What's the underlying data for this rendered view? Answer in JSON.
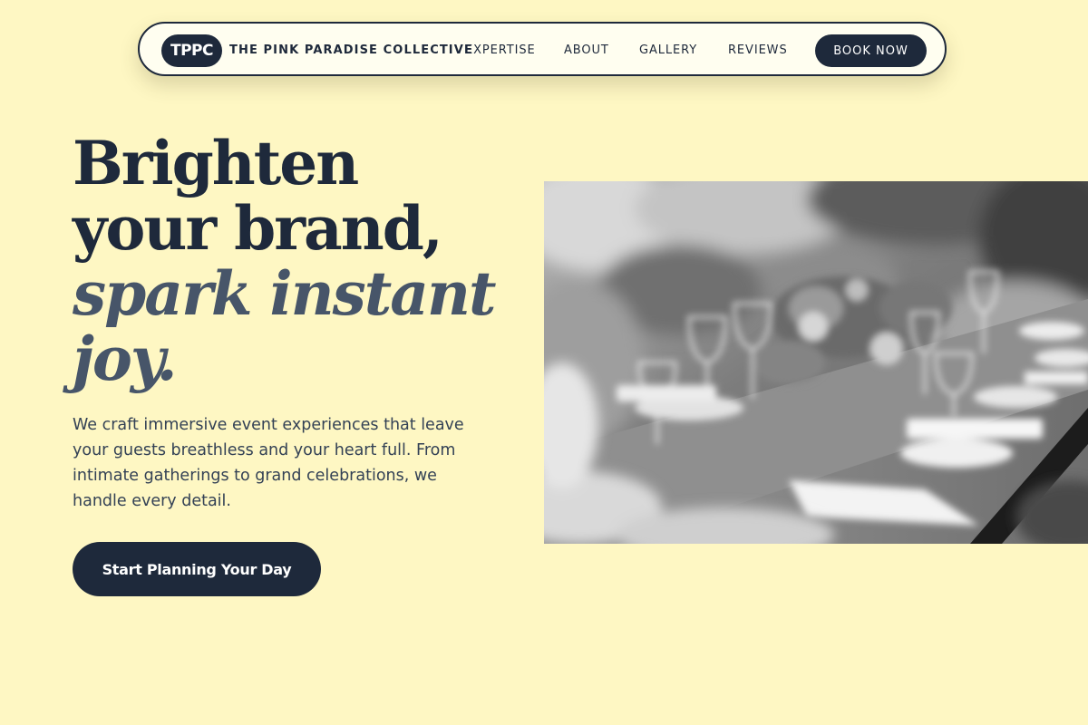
{
  "brand": {
    "logo": "TPPC",
    "name": "THE PINK PARADISE COLLECTIVE"
  },
  "nav": {
    "links": [
      "EXPERTISE",
      "ABOUT",
      "GALLERY",
      "REVIEWS"
    ],
    "cta": "BOOK NOW"
  },
  "hero": {
    "title_lines": [
      "Brighten",
      "your brand,"
    ],
    "title_accent_lines": [
      "spark instant",
      "joy."
    ],
    "description": "We craft immersive event experiences that leave your guests breathless and your heart full. From intimate gatherings to grand celebrations, we handle every detail.",
    "cta": "Start Planning Your Day"
  },
  "colors": {
    "background": "#fef7c3",
    "navy": "#1e293b",
    "accent_slate": "#475569"
  }
}
